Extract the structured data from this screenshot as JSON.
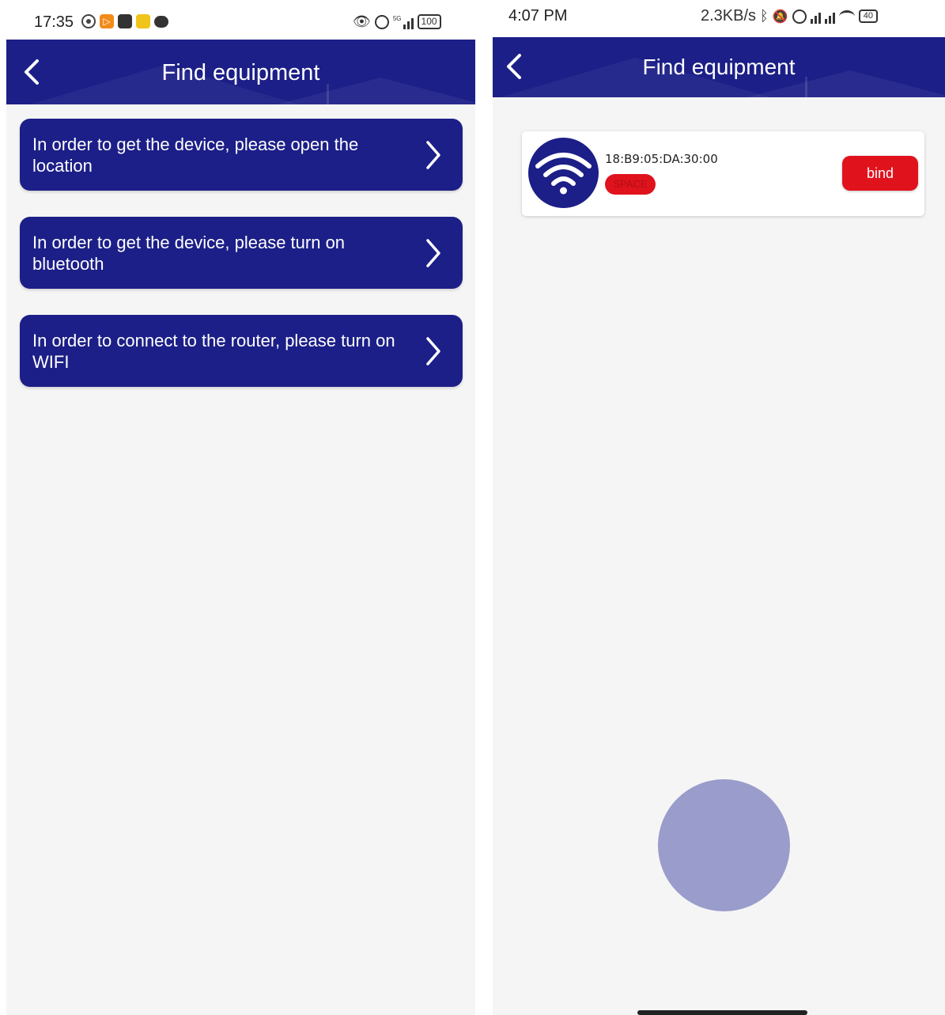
{
  "left_screen": {
    "status_bar": {
      "time": "17:35",
      "signal_label": "5G",
      "battery": "100"
    },
    "header": {
      "title": "Find equipment",
      "back_icon": "chevron-left-icon"
    },
    "permission_items": [
      {
        "text": "In order to get the device, please open the location",
        "icon": "chevron-right-icon"
      },
      {
        "text": "In order to get the device, please turn on bluetooth",
        "icon": "chevron-right-icon"
      },
      {
        "text": "In order to connect to the router, please turn on WIFI",
        "icon": "chevron-right-icon"
      }
    ]
  },
  "right_screen": {
    "status_bar": {
      "time": "4:07 PM",
      "net_speed": "2.3KB/s",
      "battery": "40"
    },
    "header": {
      "title": "Find equipment",
      "back_icon": "chevron-left-icon"
    },
    "device": {
      "icon": "wifi-icon",
      "mac": "18:B9:05:DA:30:00",
      "type_label": "SPACE",
      "bind_label": "bind"
    },
    "colors": {
      "primary": "#1c1f87",
      "accent": "#e0131d",
      "background": "#f5f5f5",
      "loading": "#9a9ccb"
    }
  }
}
